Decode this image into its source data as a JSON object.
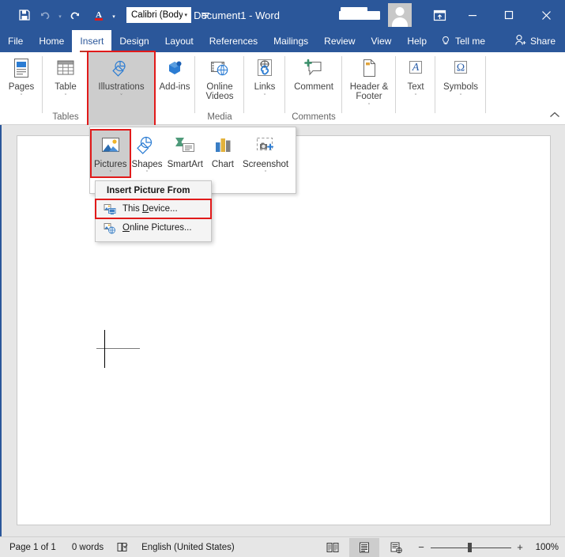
{
  "window": {
    "document_title": "Document1  -  Word",
    "minimize_label": "─",
    "maximize_label": "☐",
    "close_label": "✕",
    "ribbon_display_options_icon": "ribbon-display-options-icon",
    "account_name_redacted": "",
    "avatar_icon": "account-avatar-icon"
  },
  "quick_access": {
    "save": {
      "label": "save-icon",
      "title": "Save"
    },
    "undo": {
      "label": "undo-icon",
      "title": "Undo"
    },
    "redo": {
      "label": "redo-icon",
      "title": "Redo"
    },
    "font_color": {
      "label": "font-color-icon",
      "title": "Font Color",
      "color": "#e11a1a"
    },
    "font_name": {
      "value": "Calibri (Body",
      "caret": "▾"
    },
    "customize": {
      "label": "customize-quick-access-toolbar-icon"
    }
  },
  "tabs": [
    {
      "label": "File",
      "active": false
    },
    {
      "label": "Home",
      "active": false
    },
    {
      "label": "Insert",
      "active": true
    },
    {
      "label": "Design",
      "active": false
    },
    {
      "label": "Layout",
      "active": false
    },
    {
      "label": "References",
      "active": false
    },
    {
      "label": "Mailings",
      "active": false
    },
    {
      "label": "Review",
      "active": false
    },
    {
      "label": "View",
      "active": false
    },
    {
      "label": "Help",
      "active": false
    }
  ],
  "tell_me": {
    "label": "Tell me",
    "icon": "lightbulb-icon"
  },
  "share": {
    "label": "Share",
    "icon": "share-person-icon"
  },
  "ribbon": {
    "groups": [
      {
        "name": "pages",
        "group_label": "",
        "buttons": [
          {
            "label": "Pages",
            "icon": "pages-icon",
            "caret": "ˇ"
          }
        ]
      },
      {
        "name": "tables",
        "group_label": "Tables",
        "buttons": [
          {
            "label": "Table",
            "icon": "table-icon",
            "caret": "ˇ"
          }
        ]
      },
      {
        "name": "illustrations",
        "group_label": "",
        "highlighted": true,
        "buttons": [
          {
            "label": "Illustrations",
            "icon": "illustrations-icon",
            "caret": "ˇ"
          }
        ]
      },
      {
        "name": "add-ins",
        "group_label": "",
        "buttons": [
          {
            "label": "Add-ins",
            "icon": "add-ins-icon",
            "caret": "ˇ"
          }
        ]
      },
      {
        "name": "media",
        "group_label": "Media",
        "buttons": [
          {
            "label": "Online Videos",
            "icon": "online-videos-icon",
            "caret": ""
          }
        ]
      },
      {
        "name": "links",
        "group_label": "",
        "buttons": [
          {
            "label": "Links",
            "icon": "links-icon",
            "caret": "ˇ"
          }
        ]
      },
      {
        "name": "comments",
        "group_label": "Comments",
        "buttons": [
          {
            "label": "Comment",
            "icon": "comment-icon",
            "caret": ""
          }
        ]
      },
      {
        "name": "header-footer",
        "group_label": "",
        "buttons": [
          {
            "label": "Header & Footer",
            "icon": "header-footer-icon",
            "caret": "ˇ"
          }
        ]
      },
      {
        "name": "text",
        "group_label": "",
        "buttons": [
          {
            "label": "Text",
            "icon": "text-icon",
            "caret": "ˇ"
          }
        ]
      },
      {
        "name": "symbols",
        "group_label": "",
        "buttons": [
          {
            "label": "Symbols",
            "icon": "symbols-icon",
            "caret": "ˇ"
          }
        ]
      }
    ],
    "collapse_icon": "collapse-ribbon-icon"
  },
  "illustrations_gallery": {
    "items": [
      {
        "label": "Pictures",
        "icon": "pictures-icon",
        "caret": "ˇ",
        "selected": true
      },
      {
        "label": "Shapes",
        "icon": "shapes-icon",
        "caret": "ˇ",
        "selected": false
      },
      {
        "label": "SmartArt",
        "icon": "smartart-icon",
        "caret": "",
        "selected": false
      },
      {
        "label": "Chart",
        "icon": "chart-icon",
        "caret": "",
        "selected": false
      },
      {
        "label": "Screenshot",
        "icon": "screenshot-icon",
        "caret": "ˇ",
        "selected": false
      }
    ]
  },
  "context_menu": {
    "header": "Insert Picture From",
    "items": [
      {
        "label_pre": "This ",
        "label_key": "D",
        "label_post": "evice...",
        "icon": "picture-from-device-icon",
        "selected": true
      },
      {
        "label_pre": "",
        "label_key": "O",
        "label_post": "nline Pictures...",
        "icon": "picture-from-online-icon",
        "selected": false
      }
    ]
  },
  "status_bar": {
    "page": "Page 1 of 1",
    "words": "0 words",
    "proofing_icon": "proofing-errors-icon",
    "language": "English (United States)",
    "views": [
      {
        "name": "read-mode",
        "icon": "read-mode-icon",
        "active": false
      },
      {
        "name": "print-layout",
        "icon": "print-layout-icon",
        "active": true
      },
      {
        "name": "web-layout",
        "icon": "web-layout-icon",
        "active": false
      }
    ],
    "zoom_out": "−",
    "zoom_in": "+",
    "zoom_level": "100%",
    "zoom_value": 100
  },
  "colors": {
    "word_blue": "#2b579a",
    "accent_red": "#e11a1a",
    "ribbon_bg": "#ffffff",
    "doc_bg": "#e6e6e6"
  }
}
